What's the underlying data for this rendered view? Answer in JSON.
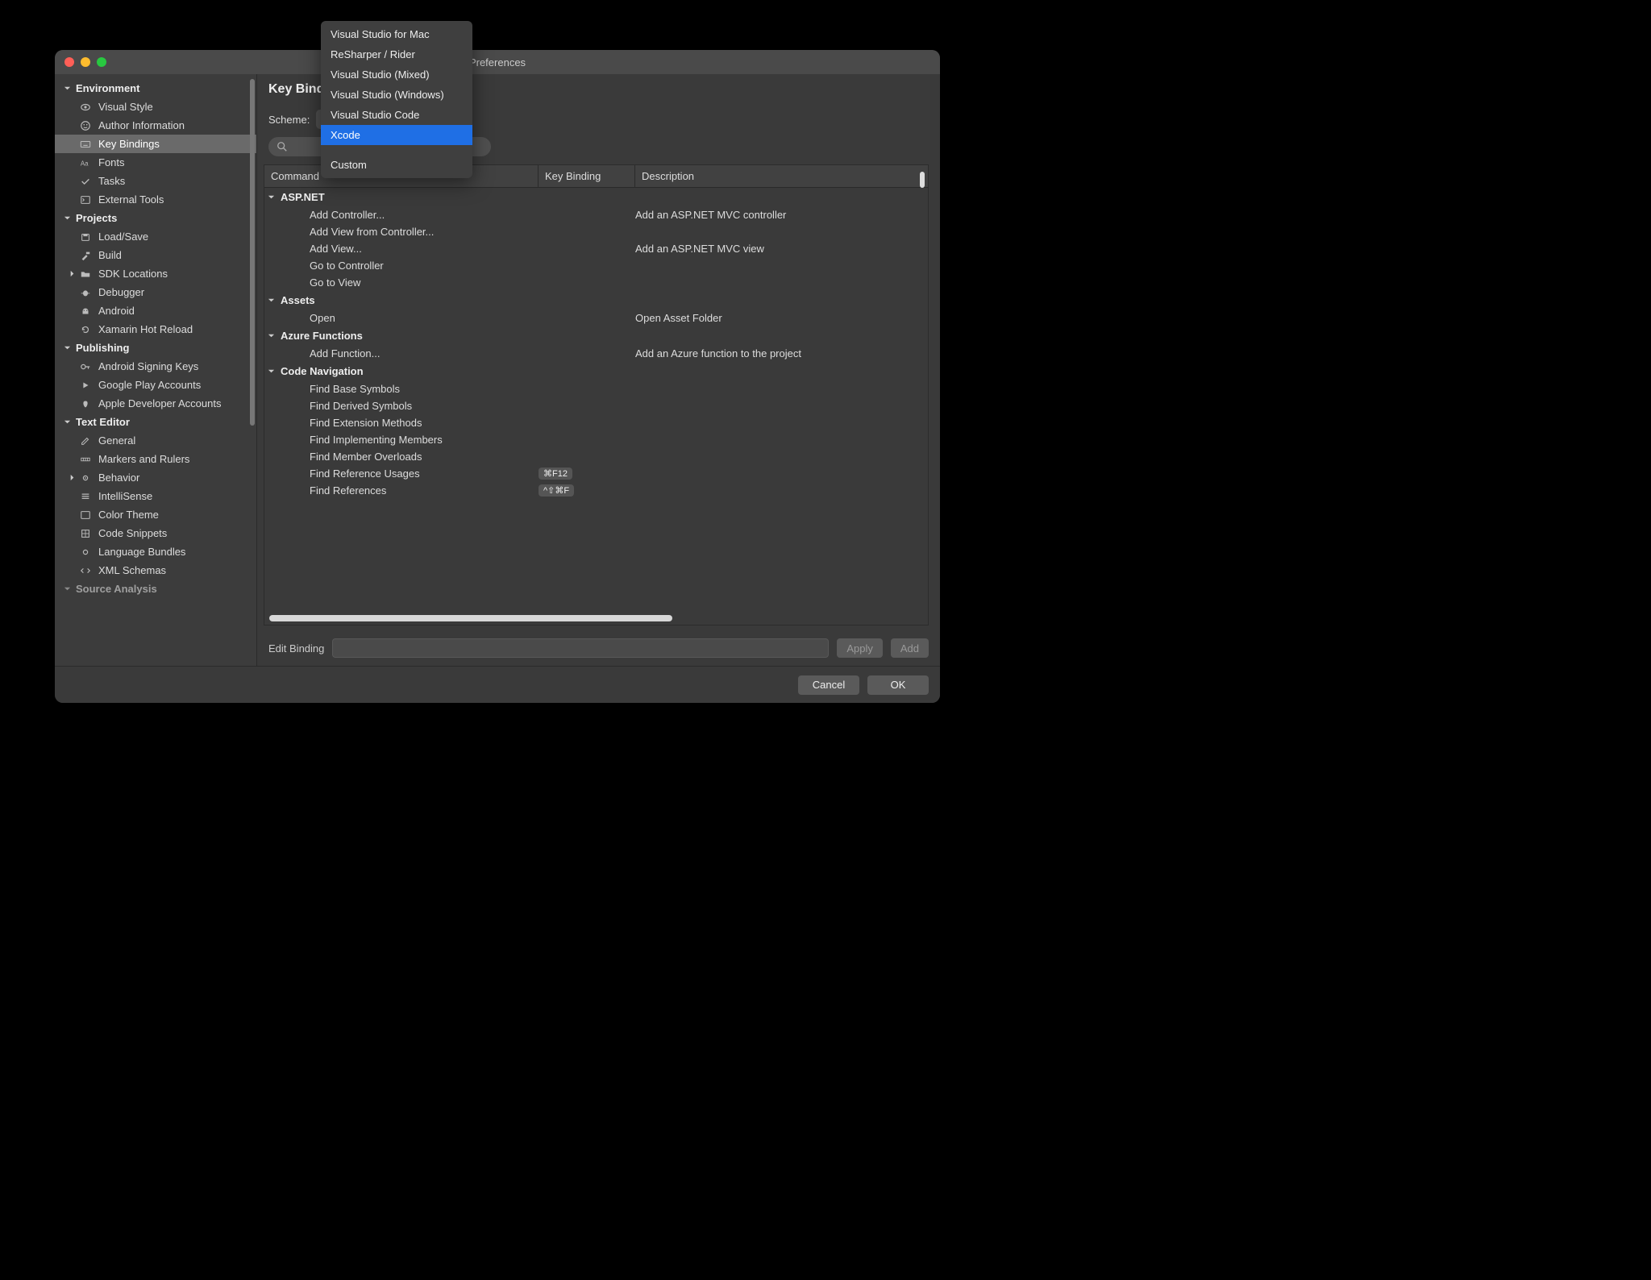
{
  "window": {
    "title": "Preferences"
  },
  "sidebar": {
    "sections": [
      {
        "label": "Environment",
        "items": [
          {
            "label": "Visual Style",
            "icon": "eye-icon"
          },
          {
            "label": "Author Information",
            "icon": "smiley-icon"
          },
          {
            "label": "Key Bindings",
            "icon": "keyboard-icon",
            "selected": true
          },
          {
            "label": "Fonts",
            "icon": "fonts-icon"
          },
          {
            "label": "Tasks",
            "icon": "check-icon"
          },
          {
            "label": "External Tools",
            "icon": "terminal-icon"
          }
        ]
      },
      {
        "label": "Projects",
        "items": [
          {
            "label": "Load/Save",
            "icon": "disk-icon"
          },
          {
            "label": "Build",
            "icon": "hammer-icon"
          },
          {
            "label": "SDK Locations",
            "icon": "folder-icon",
            "expandable": true
          },
          {
            "label": "Debugger",
            "icon": "bug-icon"
          },
          {
            "label": "Android",
            "icon": "android-icon"
          },
          {
            "label": "Xamarin Hot Reload",
            "icon": "reload-icon"
          }
        ]
      },
      {
        "label": "Publishing",
        "items": [
          {
            "label": "Android Signing Keys",
            "icon": "key-icon"
          },
          {
            "label": "Google Play Accounts",
            "icon": "play-icon"
          },
          {
            "label": "Apple Developer Accounts",
            "icon": "apple-icon"
          }
        ]
      },
      {
        "label": "Text Editor",
        "items": [
          {
            "label": "General",
            "icon": "edit-icon"
          },
          {
            "label": "Markers and Rulers",
            "icon": "rulers-icon"
          },
          {
            "label": "Behavior",
            "icon": "gears-icon",
            "expandable": true
          },
          {
            "label": "IntelliSense",
            "icon": "list-icon"
          },
          {
            "label": "Color Theme",
            "icon": "palette-icon"
          },
          {
            "label": "Code Snippets",
            "icon": "snippets-icon"
          },
          {
            "label": "Language Bundles",
            "icon": "gear-icon"
          },
          {
            "label": "XML Schemas",
            "icon": "xml-icon"
          }
        ]
      },
      {
        "label": "Source Analysis",
        "partial": true,
        "items": []
      }
    ]
  },
  "page": {
    "title": "Key Bindings",
    "scheme_label": "Scheme:",
    "search_placeholder": "",
    "edit_binding_label": "Edit Binding",
    "apply_label": "Apply",
    "add_label": "Add",
    "cancel_label": "Cancel",
    "ok_label": "OK",
    "columns": {
      "command": "Command",
      "binding": "Key Binding",
      "description": "Description"
    },
    "groups": [
      {
        "name": "ASP.NET",
        "rows": [
          {
            "cmd": "Add Controller...",
            "kb": "",
            "desc": "Add an ASP.NET MVC controller"
          },
          {
            "cmd": "Add View from Controller...",
            "kb": "",
            "desc": ""
          },
          {
            "cmd": "Add View...",
            "kb": "",
            "desc": "Add an ASP.NET MVC view"
          },
          {
            "cmd": "Go to Controller",
            "kb": "",
            "desc": ""
          },
          {
            "cmd": "Go to View",
            "kb": "",
            "desc": ""
          }
        ]
      },
      {
        "name": "Assets",
        "rows": [
          {
            "cmd": "Open",
            "kb": "",
            "desc": "Open Asset Folder"
          }
        ]
      },
      {
        "name": "Azure Functions",
        "rows": [
          {
            "cmd": "Add Function...",
            "kb": "",
            "desc": "Add an Azure function to the project"
          }
        ]
      },
      {
        "name": "Code Navigation",
        "rows": [
          {
            "cmd": "Find Base Symbols",
            "kb": "",
            "desc": ""
          },
          {
            "cmd": "Find Derived Symbols",
            "kb": "",
            "desc": ""
          },
          {
            "cmd": "Find Extension Methods",
            "kb": "",
            "desc": ""
          },
          {
            "cmd": "Find Implementing Members",
            "kb": "",
            "desc": ""
          },
          {
            "cmd": "Find Member Overloads",
            "kb": "",
            "desc": ""
          },
          {
            "cmd": "Find Reference Usages",
            "kb": "⌘F12",
            "desc": ""
          },
          {
            "cmd": "Find References",
            "kb": "^⇧⌘F",
            "desc": ""
          }
        ]
      }
    ]
  },
  "dropdown": {
    "items": [
      "Visual Studio for Mac",
      "ReSharper / Rider",
      "Visual Studio (Mixed)",
      "Visual Studio (Windows)",
      "Visual Studio Code",
      "Xcode",
      "Custom"
    ],
    "highlighted": "Xcode"
  }
}
